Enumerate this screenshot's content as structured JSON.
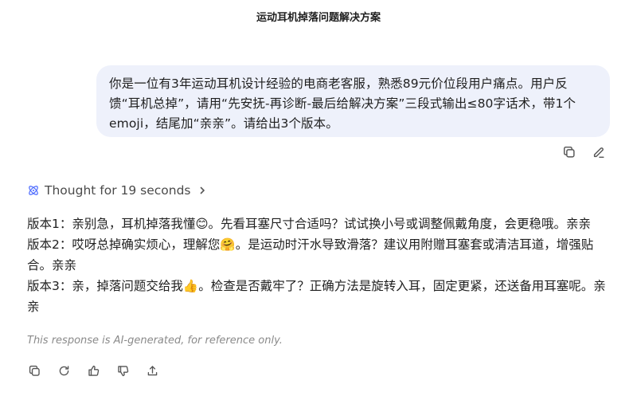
{
  "header": {
    "title": "运动耳机掉落问题解决方案"
  },
  "user_message": {
    "text": "你是一位有3年运动耳机设计经验的电商老客服，熟悉89元价位段用户痛点。用户反馈“耳机总掉”，请用“先安抚-再诊断-最后给解决方案”三段式输出≤80字话术，带1个emoji，结尾加“亲亲”。请给出3个版本。",
    "actions": {
      "copy_icon": "copy-icon",
      "edit_icon": "edit-icon"
    }
  },
  "thought": {
    "label": "Thought for 19 seconds"
  },
  "answer": {
    "v1_before": "版本1：亲别急，耳机掉落我懂",
    "v1_emoji": "😊",
    "v1_after": "。先看耳塞尺寸合适吗？试试换小号或调整佩戴角度，会更稳哦。亲亲",
    "v2_before": "版本2：哎呀总掉确实烦心，理解您",
    "v2_emoji": "🤗",
    "v2_after": "。是运动时汗水导致滑落？建议用附赠耳塞套或清洁耳道，增强贴合。亲亲",
    "v3_before": "版本3：亲，掉落问题交给我",
    "v3_emoji": "👍",
    "v3_after": "。检查是否戴牢了？正确方法是旋转入耳，固定更紧，还送备用耳塞呢。亲亲"
  },
  "disclaimer": "This response is AI-generated, for reference only.",
  "colors": {
    "bubble": "#eef1fb",
    "accent": "#4d6bfe",
    "muted": "#8a8a8a"
  }
}
